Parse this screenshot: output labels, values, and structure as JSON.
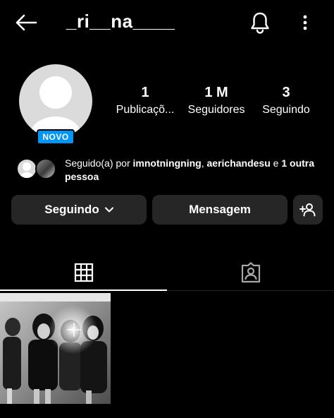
{
  "header": {
    "username": "_ri__na____",
    "back_icon": "arrow-left-icon",
    "notifications_icon": "bell-icon",
    "more_icon": "more-vertical-icon"
  },
  "profile": {
    "new_badge": "NOVO",
    "stats": [
      {
        "value": "1",
        "label": "Publicaçõ..."
      },
      {
        "value": "1 M",
        "label": "Seguidores"
      },
      {
        "value": "3",
        "label": "Seguindo"
      }
    ]
  },
  "followed_by": {
    "prefix": "Seguido(a) por ",
    "user1": "imnotningning",
    "separator": ", ",
    "user2": "aerichandesu",
    "conjunction": " e ",
    "others": "1 outra pessoa"
  },
  "actions": {
    "following_label": "Seguindo",
    "message_label": "Mensagem",
    "add_user_icon": "person-add-icon"
  },
  "tabs": [
    {
      "name": "grid",
      "icon": "grid-icon",
      "active": true
    },
    {
      "name": "tagged",
      "icon": "tagged-person-icon",
      "active": false
    }
  ],
  "posts_count": 1,
  "colors": {
    "background": "#000000",
    "button": "#262626",
    "badge": "#0095f6"
  }
}
